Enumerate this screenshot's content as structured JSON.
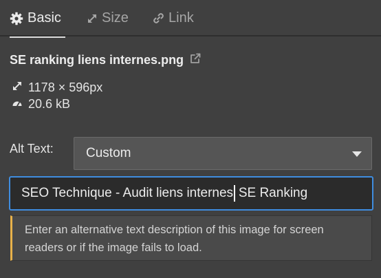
{
  "tabs": [
    {
      "label": "Basic",
      "icon": "gear-icon",
      "active": true
    },
    {
      "label": "Size",
      "icon": "resize-arrows-icon",
      "active": false
    },
    {
      "label": "Link",
      "icon": "link-icon",
      "active": false
    }
  ],
  "file": {
    "name": "SE ranking liens internes.png",
    "open_icon": "external-link-icon"
  },
  "meta": {
    "dimensions": "1178 × 596px",
    "dimensions_icon": "resize-arrows-icon",
    "filesize": "20.6 kB",
    "filesize_icon": "gauge-icon"
  },
  "alt_text": {
    "label": "Alt Text:",
    "mode": "Custom",
    "value_before_cursor": "SEO Technique - Audit liens internes",
    "value_after_cursor": " SE Ranking",
    "hint": "Enter an alternative text description of this image for screen readers or if the image fails to load."
  },
  "colors": {
    "background": "#404040",
    "focus_border": "#3f8de0",
    "hint_accent": "#e8b14a"
  }
}
